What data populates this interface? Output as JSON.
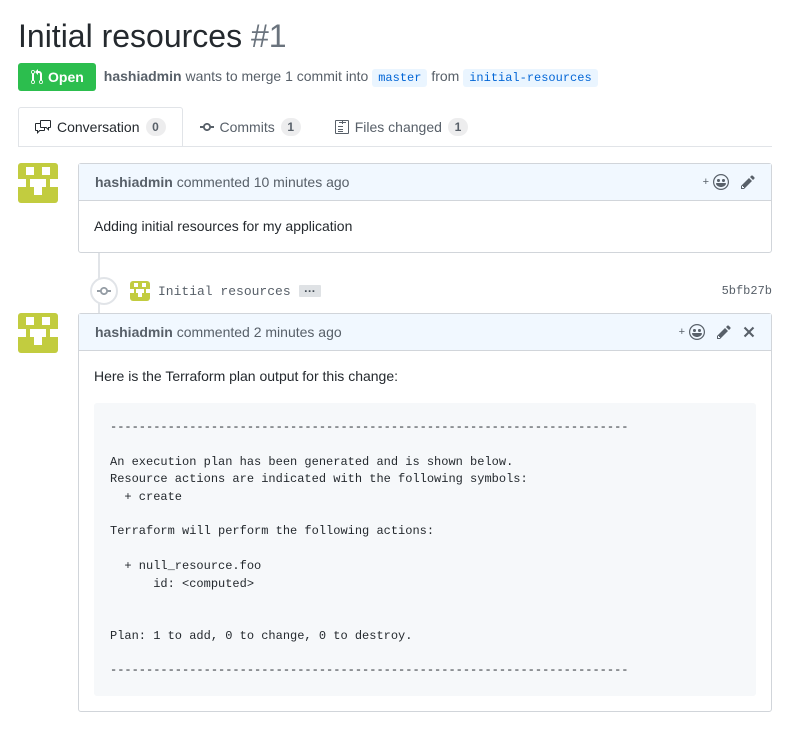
{
  "pr": {
    "title": "Initial resources",
    "number": "#1",
    "state": "Open",
    "author": "hashiadmin",
    "merge_text_1": "wants to merge 1 commit into",
    "base_branch": "master",
    "merge_text_2": "from",
    "head_branch": "initial-resources"
  },
  "tabs": {
    "conversation": {
      "label": "Conversation",
      "count": "0"
    },
    "commits": {
      "label": "Commits",
      "count": "1"
    },
    "files": {
      "label": "Files changed",
      "count": "1"
    }
  },
  "comments": [
    {
      "author": "hashiadmin",
      "timestamp": "commented 10 minutes ago",
      "body": "Adding initial resources for my application"
    },
    {
      "author": "hashiadmin",
      "timestamp": "commented 2 minutes ago",
      "intro": "Here is the Terraform plan output for this change:",
      "code": "------------------------------------------------------------------------\n\nAn execution plan has been generated and is shown below.\nResource actions are indicated with the following symbols:\n  + create\n\nTerraform will perform the following actions:\n\n  + null_resource.foo\n      id: <computed>\n\n\nPlan: 1 to add, 0 to change, 0 to destroy.\n\n------------------------------------------------------------------------"
    }
  ],
  "commit": {
    "title": "Initial resources",
    "sha": "5bfb27b",
    "ellipsis": "…"
  }
}
